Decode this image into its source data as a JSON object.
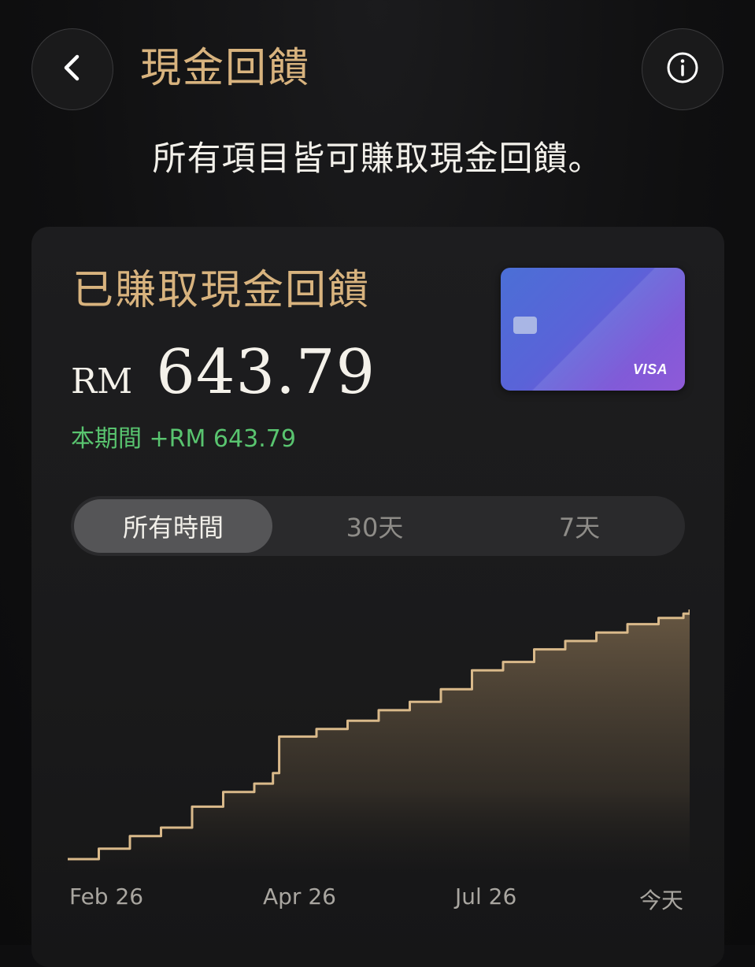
{
  "header": {
    "title": "現金回饋",
    "back_icon": "chevron-left-icon",
    "info_icon": "info-icon"
  },
  "subtitle": "所有項目皆可賺取現金回饋。",
  "summary": {
    "label": "已賺取現金回饋",
    "currency": "RM",
    "amount": "643.79",
    "period_change": "本期間 +RM 643.79",
    "card_brand": "VISA"
  },
  "range_tabs": {
    "items": [
      "所有時間",
      "30天",
      "7天"
    ],
    "selected": "所有時間"
  },
  "colors": {
    "accent_gold": "#d8b37e",
    "positive_green": "#59c46f",
    "line": "#d9b98a"
  },
  "chart_data": {
    "type": "area",
    "x_tick_labels": [
      "Feb 26",
      "Apr 26",
      "Jul 26",
      "今天"
    ],
    "x": [
      0,
      0.05,
      0.1,
      0.15,
      0.2,
      0.25,
      0.3,
      0.33,
      0.34,
      0.4,
      0.45,
      0.5,
      0.55,
      0.6,
      0.65,
      0.7,
      0.75,
      0.8,
      0.85,
      0.9,
      0.95,
      0.99,
      1.0
    ],
    "values": [
      0,
      25,
      55,
      75,
      125,
      160,
      180,
      205,
      292,
      310,
      330,
      355,
      375,
      405,
      450,
      470,
      500,
      520,
      540,
      560,
      575,
      585,
      595
    ],
    "ylim": [
      0,
      643.79
    ],
    "grid": false,
    "legend": "none"
  }
}
